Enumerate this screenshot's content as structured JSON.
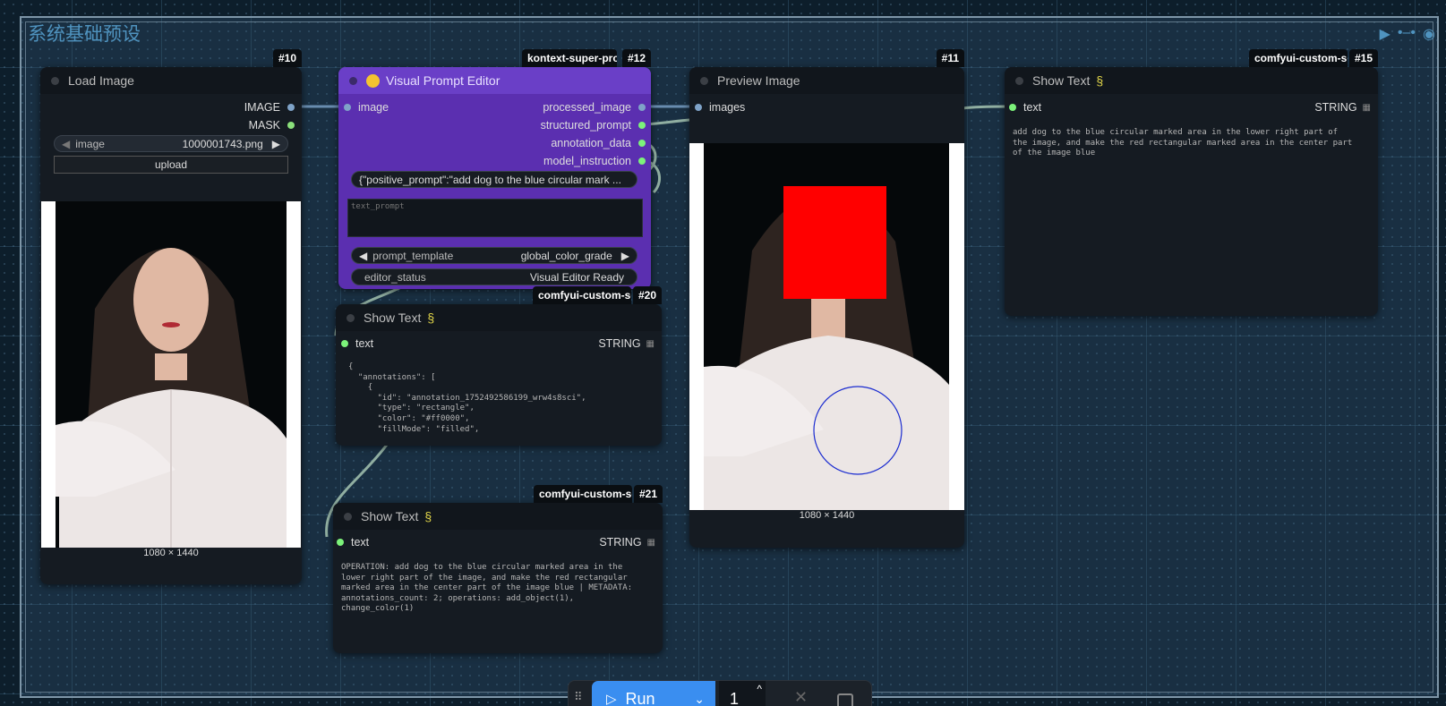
{
  "group": {
    "title": "系统基础预设",
    "icons": [
      "play-icon",
      "chain-icon",
      "eye-icon"
    ]
  },
  "load_image": {
    "id": "#10",
    "title": "Load Image",
    "outputs": [
      "IMAGE",
      "MASK"
    ],
    "widget_label": "image",
    "widget_value": "1000001743.png",
    "upload_label": "upload",
    "dims": "1080 × 1440"
  },
  "visual_prompt": {
    "id": "#12",
    "badge": "kontext-super-pro",
    "title": "Visual Prompt Editor",
    "input": "image",
    "outputs": [
      "processed_image",
      "structured_prompt",
      "annotation_data",
      "model_instruction"
    ],
    "json_preview": "{\"positive_prompt\":\"add dog to the blue circular mark ...",
    "text_placeholder": "text_prompt",
    "template_label": "prompt_template",
    "template_value": "global_color_grade",
    "status_label": "editor_status",
    "status_value": "Visual Editor Ready",
    "accent": "#5b2fb0"
  },
  "preview_image": {
    "id": "#11",
    "title": "Preview Image",
    "input": "images",
    "dims": "1080 × 1440"
  },
  "show_text_15": {
    "id": "#15",
    "badge": "comfyui-custom-sc",
    "title": "Show Text",
    "input": "text",
    "output": "STRING",
    "content": "add dog to the blue circular marked area in the lower right part of\nthe image, and make the red rectangular marked area in the center part\nof the image blue"
  },
  "show_text_20": {
    "id": "#20",
    "badge": "comfyui-custom-sc",
    "title": "Show Text",
    "input": "text",
    "output": "STRING",
    "content": "{\n  \"annotations\": [\n    {\n      \"id\": \"annotation_1752492586199_wrw4s8sci\",\n      \"type\": \"rectangle\",\n      \"color\": \"#ff0000\",\n      \"fillMode\": \"filled\","
  },
  "show_text_21": {
    "id": "#21",
    "badge": "comfyui-custom-sc",
    "title": "Show Text",
    "input": "text",
    "output": "STRING",
    "content": "OPERATION: add dog to the blue circular marked area in the\nlower right part of the image, and make the red rectangular\nmarked area in the center part of the image blue | METADATA:\nannotations_count: 2; operations: add_object(1),\nchange_color(1)"
  },
  "toolbar": {
    "run_label": "Run",
    "batch_count": "1"
  },
  "colors": {
    "annotation_rect": "#ff0000",
    "annotation_circle": "#1a2bd0"
  }
}
